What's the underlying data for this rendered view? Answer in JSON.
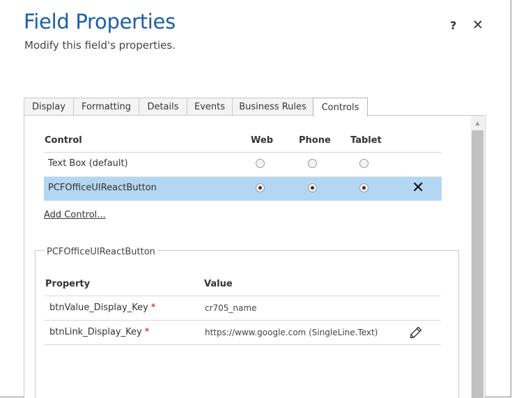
{
  "header": {
    "title": "Field Properties",
    "subtitle": "Modify this field's properties.",
    "help_label": "?",
    "close_label": "✕"
  },
  "tabs": [
    {
      "label": "Display"
    },
    {
      "label": "Formatting"
    },
    {
      "label": "Details"
    },
    {
      "label": "Events"
    },
    {
      "label": "Business Rules"
    },
    {
      "label": "Controls",
      "active": true
    }
  ],
  "controls_table": {
    "columns": [
      "Control",
      "Web",
      "Phone",
      "Tablet"
    ],
    "rows": [
      {
        "name": "Text Box (default)",
        "web": false,
        "phone": false,
        "tablet": false,
        "selected": false
      },
      {
        "name": "PCFOfficeUIReactButton",
        "web": true,
        "phone": true,
        "tablet": true,
        "selected": true
      }
    ],
    "remove_label": "✕",
    "add_control_label": "Add Control..."
  },
  "properties_group": {
    "legend": "PCFOfficeUIReactButton",
    "columns": [
      "Property",
      "Value"
    ],
    "rows": [
      {
        "property": "btnValue_Display_Key",
        "required_mark": "*",
        "value": "cr705_name"
      },
      {
        "property": "btnLink_Display_Key",
        "required_mark": "*",
        "value": "https://www.google.com (SingleLine.Text)"
      }
    ]
  },
  "colors": {
    "title": "#1b5ea8",
    "selected_row": "#b3d7f2",
    "required": "#c00000"
  }
}
